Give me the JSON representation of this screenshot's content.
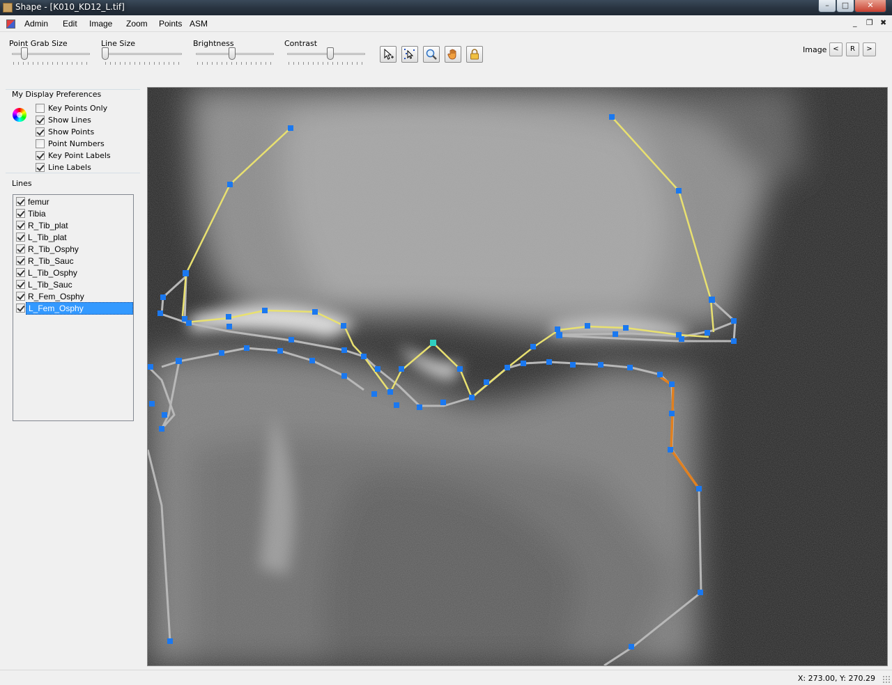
{
  "window": {
    "title": "Shape - [K010_KD12_L.tif]",
    "minimize_glyph": "–",
    "maximize_glyph": "□",
    "close_glyph": "✕"
  },
  "menu": {
    "items": [
      "Admin",
      "Edit",
      "Image",
      "Zoom",
      "Points",
      "ASM"
    ],
    "mdi_minimize": "_",
    "mdi_restore": "❐",
    "mdi_close": "✖"
  },
  "toolbar": {
    "sliders": [
      {
        "label": "Point Grab Size",
        "level": 0.16
      },
      {
        "label": "Line Size",
        "level": 0.0
      },
      {
        "label": "Brightness",
        "level": 0.5
      },
      {
        "label": "Contrast",
        "level": 0.6
      }
    ],
    "tools": [
      "select-pointer-icon",
      "multi-select-icon",
      "magnifier-icon",
      "hand-pan-icon",
      "padlock-icon"
    ],
    "image_label": "Image",
    "prev_label": "<",
    "reset_label": "R",
    "next_label": ">"
  },
  "preferences": {
    "title": "My Display Preferences",
    "options": [
      {
        "label": "Key Points Only",
        "checked": false
      },
      {
        "label": "Show Lines",
        "checked": true
      },
      {
        "label": "Show Points",
        "checked": true
      },
      {
        "label": "Point Numbers",
        "checked": false
      },
      {
        "label": "Key Point Labels",
        "checked": true
      },
      {
        "label": "Line Labels",
        "checked": true
      }
    ]
  },
  "lines": {
    "title": "Lines",
    "items": [
      {
        "label": "femur",
        "checked": true,
        "selected": false
      },
      {
        "label": "Tibia",
        "checked": true,
        "selected": false
      },
      {
        "label": "R_Tib_plat",
        "checked": true,
        "selected": false
      },
      {
        "label": "L_Tib_plat",
        "checked": true,
        "selected": false
      },
      {
        "label": "R_Tib_Osphy",
        "checked": true,
        "selected": false
      },
      {
        "label": "R_Tib_Sauc",
        "checked": true,
        "selected": false
      },
      {
        "label": "L_Tib_Osphy",
        "checked": true,
        "selected": false
      },
      {
        "label": "L_Tib_Sauc",
        "checked": true,
        "selected": false
      },
      {
        "label": "R_Fem_Osphy",
        "checked": true,
        "selected": false
      },
      {
        "label": "L_Fem_Osphy",
        "checked": true,
        "selected": true
      }
    ]
  },
  "colors": {
    "yellow_line": "#e8e070",
    "gray_line": "#b8b8b8",
    "orange_line": "#e08020",
    "point": "#1a78f0",
    "key_point": "#30d0c0",
    "selection": "#3399ff"
  },
  "status": {
    "coords": "X: 273.00, Y: 270.29"
  }
}
